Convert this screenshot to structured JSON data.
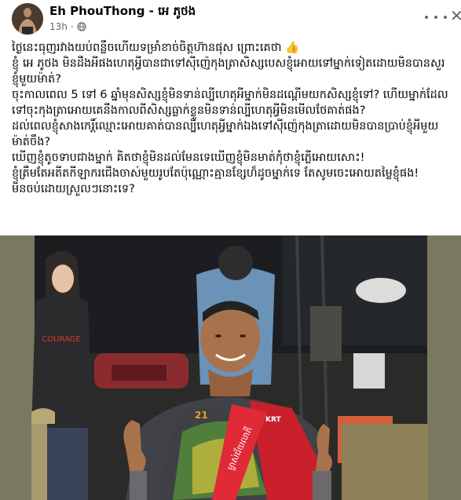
{
  "post": {
    "author": "Eh PhouThong - អេ ភូថង",
    "time": "13h",
    "privacy_icon": "globe-icon",
    "avatar_icon": "fighter-avatar",
    "paragraphs": [
      "ថ្ងៃនេះធុញរវាងយប់ពន្លឹចហើយទម្រាំខាច់ចិត្តហ៊ានផុស ព្រោះគេថា 👍",
      "ខ្ញុំ អេ ភូថង មិនដឹងអីផងហេតុអ្វីបានជាទៅស៊ីញ៉េកុងត្រាសិស្សបេសខ្ញុំអោយទៅម្នាក់ទៀតដោយមិនបានសួរខ្ញុំមួយម៉ាត់?",
      "ចុះកាលពេល 5 ទៅ 6 ឆ្នាំមុនសិស្សខ្ញុំមិនទាន់ល្បីហេតុអីម្នាក់មិនដណ្តើមយកសិស្សខ្ញុំទៅ? ហើយម្នាក់ដែលទៅចុះកុងត្រាអោយគេនឹងកាលពីសិស្សធ្លាក់ខ្លួនមិនទាន់ល្បីហេតុអ្វីមិនមើលថែគាត់ផង?",
      "ដល់ពេលខ្ញុំសាងកេរ្តិ៍ឈ្មោះអោយគាត់បានល្បីហេតុអ្វីម្នាក់ឯងទៅស៊ីញ៉េកុងត្រាដោយមិនបានប្រាប់ខ្ញុំអីមួយម៉ាត់ចឹង?",
      "ឃើញខ្ញុំតូចទាបជាងម្នាក់ គិតថាខ្ញុំមិនដល់មែនទេឃើញខ្ញុំមិនមាត់កុំថាខ្ញុំភ្លើអោយសោះ!",
      "ខ្ញុំត្រឹមតែអតីតកីឡាករជើងចាស់មួយរូបតែប៉ុណ្ណោះគ្មានខ្សែហ៏ដូចម្នាក់ទេ តែសូមចេះអោយតម្លៃខ្ញុំផង!",
      "មិនចប់ដោយស្រួលៗនោះទេ?"
    ]
  },
  "photo": {
    "banner_text": "ម្ចាស់ជ័យលាភី",
    "jersey_badge": "KRT",
    "jersey_logo": "21"
  }
}
